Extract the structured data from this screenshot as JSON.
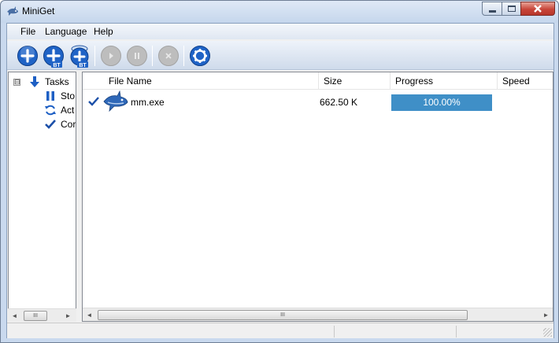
{
  "window": {
    "title": "MiniGet"
  },
  "menu": {
    "items": [
      "File",
      "Language",
      "Help"
    ]
  },
  "toolbar": {
    "buttons": [
      {
        "name": "add-task",
        "icon": "plus-icon",
        "enabled": true
      },
      {
        "name": "add-bt-task",
        "icon": "plus-bt-icon",
        "badge": "BT",
        "enabled": true
      },
      {
        "name": "add-bt-batch",
        "icon": "plus-bt-stack-icon",
        "badge": "BT",
        "enabled": true
      },
      {
        "name": "start",
        "icon": "play-icon",
        "enabled": false
      },
      {
        "name": "pause",
        "icon": "pause-icon",
        "enabled": false
      },
      {
        "name": "delete",
        "icon": "x-icon",
        "enabled": false
      },
      {
        "name": "settings",
        "icon": "gear-icon",
        "enabled": true
      }
    ]
  },
  "tree": {
    "root": {
      "label": "Tasks",
      "expander": "⊟",
      "icon": "arrow-down-icon"
    },
    "children": [
      {
        "label": "Sto",
        "icon": "pause-icon"
      },
      {
        "label": "Act",
        "icon": "refresh-icon"
      },
      {
        "label": "Cor",
        "icon": "check-icon"
      }
    ]
  },
  "list": {
    "columns": [
      "File Name",
      "Size",
      "Progress",
      "Speed"
    ],
    "rows": [
      {
        "status_icon": "check-icon",
        "file_icon": "shark-icon",
        "name": "mm.exe",
        "size": "662.50 K",
        "progress": 1.0,
        "progress_text": "100.00%",
        "speed": ""
      }
    ]
  },
  "scrollbars": {
    "thumb_glyph": "III",
    "left": "◄",
    "right": "►"
  },
  "colors": {
    "accent": "#3f8fc7",
    "toolbar_blue": "#1f63c6",
    "check": "#1b4fa8"
  }
}
